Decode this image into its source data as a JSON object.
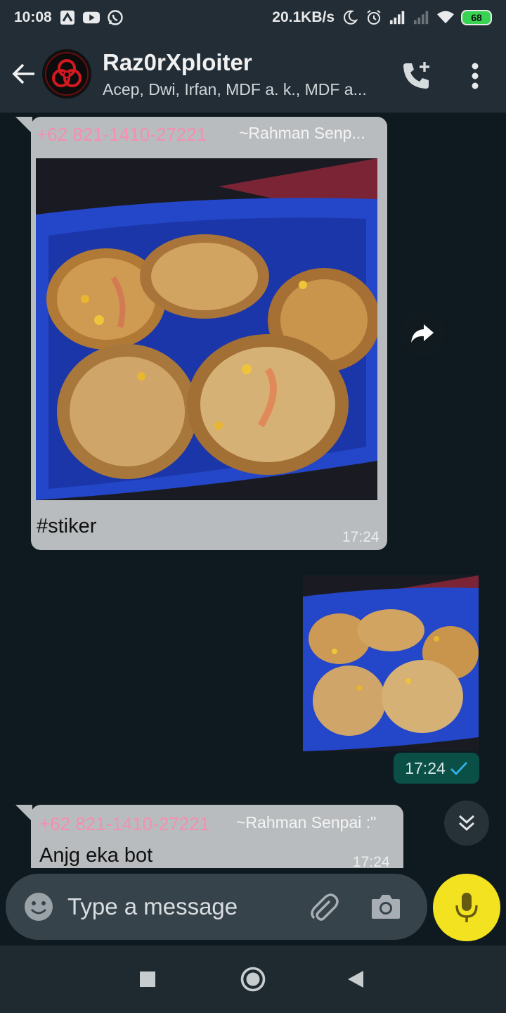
{
  "status_bar": {
    "time": "10:08",
    "speed": "20.1KB/s",
    "battery": "68"
  },
  "header": {
    "title": "Raz0rXploiter",
    "subtitle": "Acep, Dwi, Irfan, MDF a. k., MDF a..."
  },
  "messages": [
    {
      "direction": "incoming",
      "sender": "+62 821-1410-27221",
      "pushname": "~Rahman Senp...",
      "type": "image",
      "caption": "#stiker",
      "time": "17:24"
    },
    {
      "direction": "outgoing",
      "type": "sticker",
      "time": "17:24",
      "status": "read"
    },
    {
      "direction": "incoming",
      "sender": "+62 821-1410-27221",
      "pushname": "~Rahman Senpai :\"",
      "type": "text",
      "text": "Anjg eka bot",
      "time": "17:24"
    }
  ],
  "composer": {
    "placeholder": "Type a message"
  },
  "colors": {
    "chat_bg": "#0e1a20",
    "header_bg": "#232d36",
    "incoming_bubble": "#b9bcbe",
    "sender_name": "#f48fb1",
    "outgoing_time_chip": "#0b5047",
    "read_tick": "#34b7f1",
    "mic_button": "#f2e21f"
  },
  "icons": {
    "status": [
      "smart-home-icon",
      "youtube-icon",
      "whatsapp-icon",
      "moon-icon",
      "alarm-icon",
      "signal-icon",
      "signal-weak-icon",
      "wifi-icon",
      "battery-icon"
    ],
    "header": [
      "back-arrow-icon",
      "group-avatar-icon",
      "add-call-icon",
      "more-vert-icon"
    ],
    "chat": [
      "forward-icon",
      "read-tick-icon",
      "chevron-double-down-icon"
    ],
    "composer": [
      "emoji-icon",
      "paperclip-icon",
      "camera-icon",
      "mic-icon"
    ],
    "nav": [
      "recents-square-icon",
      "home-circle-icon",
      "back-triangle-icon"
    ]
  }
}
